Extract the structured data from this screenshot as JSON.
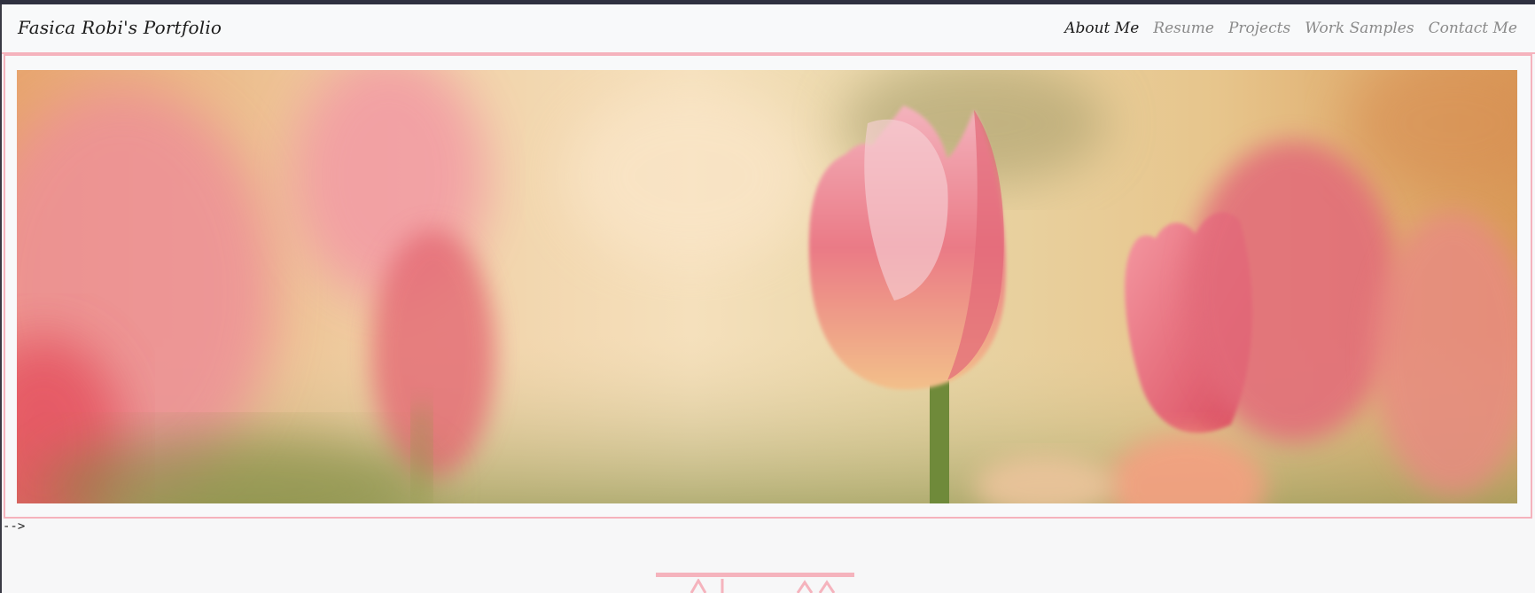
{
  "navbar": {
    "brand": "Fasica Robi's Portfolio",
    "items": [
      {
        "label": "About Me",
        "active": true
      },
      {
        "label": "Resume",
        "active": false
      },
      {
        "label": "Projects",
        "active": false
      },
      {
        "label": "Work Samples",
        "active": false
      },
      {
        "label": "Contact Me",
        "active": false
      }
    ]
  },
  "hero": {
    "image_subject": "pink tulips blurred background"
  },
  "stray_text": "-->",
  "colors": {
    "accent_pink": "#f5b3bd",
    "navbar_bg": "#f8f9fa",
    "page_bg": "#f7f7f8"
  }
}
